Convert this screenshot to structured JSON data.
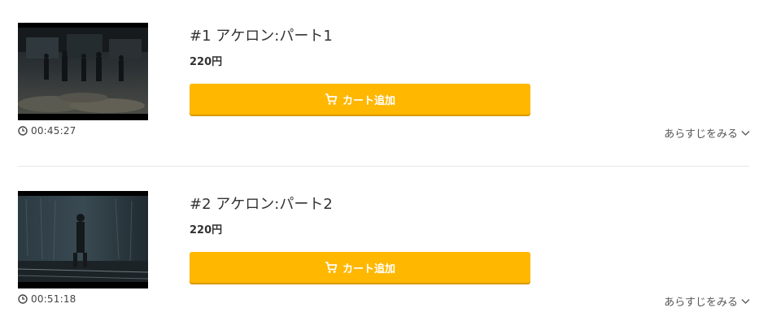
{
  "episodes": [
    {
      "title": "#1 アケロン:パート1",
      "price": "220円",
      "duration": "00:45:27",
      "cart_label": "カート追加",
      "synopsis_label": "あらすじをみる",
      "thumbnail_icon": "video-still"
    },
    {
      "title": "#2 アケロン:パート2",
      "price": "220円",
      "duration": "00:51:18",
      "cart_label": "カート追加",
      "synopsis_label": "あらすじをみる",
      "thumbnail_icon": "video-still"
    }
  ],
  "colors": {
    "button": "#ffb700",
    "button_text": "#ffffff",
    "divider": "#e6e6e6",
    "text": "#333333"
  },
  "icons": {
    "clock": "clock-icon",
    "cart": "cart-icon",
    "chevron": "chevron-down-icon"
  }
}
